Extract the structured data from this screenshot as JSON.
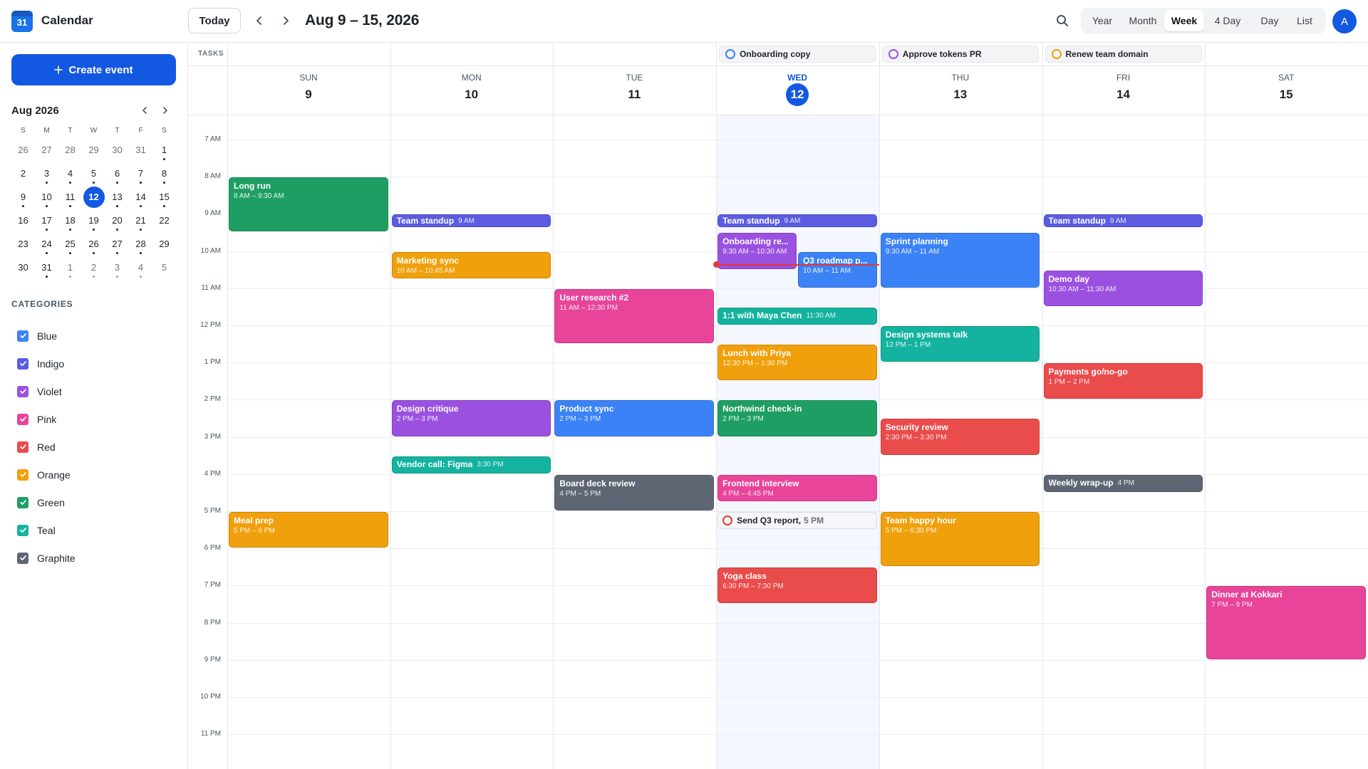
{
  "app": {
    "title": "Calendar",
    "logo_day": "31"
  },
  "toolbar": {
    "today_label": "Today",
    "range_title": "Aug 9 – 15, 2026"
  },
  "views": [
    {
      "label": "Year",
      "active": false
    },
    {
      "label": "Month",
      "active": false
    },
    {
      "label": "Week",
      "active": true
    },
    {
      "label": "4 Day",
      "active": false
    },
    {
      "label": "Day",
      "active": false
    },
    {
      "label": "List",
      "active": false
    }
  ],
  "user": {
    "avatar_initial": "A"
  },
  "sidebar": {
    "create_label": "Create event",
    "mini_calendar": {
      "title": "Aug 2026",
      "weekdays": [
        "S",
        "M",
        "T",
        "W",
        "T",
        "F",
        "S"
      ],
      "weeks": [
        [
          {
            "d": "26",
            "o": true,
            "dot": false
          },
          {
            "d": "27",
            "o": true,
            "dot": false
          },
          {
            "d": "28",
            "o": true,
            "dot": false
          },
          {
            "d": "29",
            "o": true,
            "dot": false
          },
          {
            "d": "30",
            "o": true,
            "dot": false
          },
          {
            "d": "31",
            "o": true,
            "dot": false
          },
          {
            "d": "1",
            "o": false,
            "dot": true
          }
        ],
        [
          {
            "d": "2",
            "o": false,
            "dot": false
          },
          {
            "d": "3",
            "o": false,
            "dot": true
          },
          {
            "d": "4",
            "o": false,
            "dot": true
          },
          {
            "d": "5",
            "o": false,
            "dot": true
          },
          {
            "d": "6",
            "o": false,
            "dot": true
          },
          {
            "d": "7",
            "o": false,
            "dot": true
          },
          {
            "d": "8",
            "o": false,
            "dot": true
          }
        ],
        [
          {
            "d": "9",
            "o": false,
            "dot": true
          },
          {
            "d": "10",
            "o": false,
            "dot": true
          },
          {
            "d": "11",
            "o": false,
            "dot": true
          },
          {
            "d": "12",
            "o": false,
            "dot": false,
            "today": true
          },
          {
            "d": "13",
            "o": false,
            "dot": true
          },
          {
            "d": "14",
            "o": false,
            "dot": true
          },
          {
            "d": "15",
            "o": false,
            "dot": true
          }
        ],
        [
          {
            "d": "16",
            "o": false,
            "dot": false
          },
          {
            "d": "17",
            "o": false,
            "dot": true
          },
          {
            "d": "18",
            "o": false,
            "dot": true
          },
          {
            "d": "19",
            "o": false,
            "dot": true
          },
          {
            "d": "20",
            "o": false,
            "dot": true
          },
          {
            "d": "21",
            "o": false,
            "dot": true
          },
          {
            "d": "22",
            "o": false,
            "dot": false
          }
        ],
        [
          {
            "d": "23",
            "o": false,
            "dot": false
          },
          {
            "d": "24",
            "o": false,
            "dot": true
          },
          {
            "d": "25",
            "o": false,
            "dot": true
          },
          {
            "d": "26",
            "o": false,
            "dot": true
          },
          {
            "d": "27",
            "o": false,
            "dot": true
          },
          {
            "d": "28",
            "o": false,
            "dot": true
          },
          {
            "d": "29",
            "o": false,
            "dot": false
          }
        ],
        [
          {
            "d": "30",
            "o": false,
            "dot": false
          },
          {
            "d": "31",
            "o": false,
            "dot": true
          },
          {
            "d": "1",
            "o": true,
            "dot": true
          },
          {
            "d": "2",
            "o": true,
            "dot": true
          },
          {
            "d": "3",
            "o": true,
            "dot": true
          },
          {
            "d": "4",
            "o": true,
            "dot": true
          },
          {
            "d": "5",
            "o": true,
            "dot": false
          }
        ]
      ]
    },
    "categories_title": "CATEGORIES",
    "categories": [
      {
        "label": "Blue",
        "color": "#3b82f6"
      },
      {
        "label": "Indigo",
        "color": "#5b5ce2"
      },
      {
        "label": "Violet",
        "color": "#9b51e0"
      },
      {
        "label": "Pink",
        "color": "#e8449a"
      },
      {
        "label": "Red",
        "color": "#ea4b4b"
      },
      {
        "label": "Orange",
        "color": "#f0a00c"
      },
      {
        "label": "Green",
        "color": "#1e9e63"
      },
      {
        "label": "Teal",
        "color": "#14b3a0"
      },
      {
        "label": "Graphite",
        "color": "#5f6673"
      }
    ]
  },
  "week": {
    "tasks_label": "TASKS",
    "tasks": [
      {
        "label": "Onboarding copy",
        "day": 3,
        "color": "#3b82f6"
      },
      {
        "label": "Approve tokens PR",
        "day": 4,
        "color": "#9b51e0"
      },
      {
        "label": "Renew team domain",
        "day": 5,
        "color": "#f0a00c"
      }
    ],
    "days": [
      {
        "name": "SUN",
        "num": "9",
        "today": false
      },
      {
        "name": "MON",
        "num": "10",
        "today": false
      },
      {
        "name": "TUE",
        "num": "11",
        "today": false
      },
      {
        "name": "WED",
        "num": "12",
        "today": true
      },
      {
        "name": "THU",
        "num": "13",
        "today": false
      },
      {
        "name": "FRI",
        "num": "14",
        "today": false
      },
      {
        "name": "SAT",
        "num": "15",
        "today": false
      }
    ],
    "hours": [
      "7 AM",
      "8 AM",
      "9 AM",
      "10 AM",
      "11 AM",
      "12 PM",
      "1 PM",
      "2 PM",
      "3 PM",
      "4 PM",
      "5 PM",
      "6 PM",
      "7 PM",
      "8 PM",
      "9 PM",
      "10 PM",
      "11 PM"
    ],
    "now_hour": 10.35,
    "events": [
      {
        "title": "Long run",
        "time": "8 AM – 9:30 AM",
        "day": 0,
        "start": 8,
        "end": 9.5,
        "color": "#1e9e63"
      },
      {
        "title": "Meal prep",
        "time": "5 PM – 6 PM",
        "day": 0,
        "start": 17,
        "end": 18,
        "color": "#f0a00c"
      },
      {
        "title": "Team standup",
        "time": "9 AM",
        "day": 1,
        "start": 9,
        "end": 9.35,
        "color": "#5b5ce2",
        "short": true
      },
      {
        "title": "Marketing sync",
        "time": "10 AM – 10:45 AM",
        "day": 1,
        "start": 10,
        "end": 10.75,
        "color": "#f0a00c"
      },
      {
        "title": "Design critique",
        "time": "2 PM – 3 PM",
        "day": 1,
        "start": 14,
        "end": 15,
        "color": "#9b51e0"
      },
      {
        "title": "Vendor call: Figma",
        "time": "3:30 PM",
        "day": 1,
        "start": 15.5,
        "end": 16,
        "color": "#14b3a0",
        "short": true
      },
      {
        "title": "User research #2",
        "time": "11 AM – 12:30 PM",
        "day": 2,
        "start": 11,
        "end": 12.5,
        "color": "#e8449a"
      },
      {
        "title": "Product sync",
        "time": "2 PM – 3 PM",
        "day": 2,
        "start": 14,
        "end": 15,
        "color": "#3b82f6"
      },
      {
        "title": "Board deck review",
        "time": "4 PM – 5 PM",
        "day": 2,
        "start": 16,
        "end": 17,
        "color": "#5f6673"
      },
      {
        "title": "Team standup",
        "time": "9 AM",
        "day": 3,
        "start": 9,
        "end": 9.35,
        "color": "#5b5ce2",
        "short": true
      },
      {
        "title": "Onboarding re...",
        "time": "9:30 AM – 10:30 AM",
        "day": 3,
        "start": 9.5,
        "end": 10.5,
        "color": "#9b51e0",
        "lane": 0,
        "lanes": 2,
        "wrap": true
      },
      {
        "title": "Q3 roadmap p...",
        "time": "10 AM – 11 AM",
        "day": 3,
        "start": 10,
        "end": 11,
        "color": "#3b82f6",
        "lane": 1,
        "lanes": 2
      },
      {
        "title": "1:1 with Maya Chen",
        "time": "11:30 AM",
        "day": 3,
        "start": 11.5,
        "end": 12,
        "color": "#14b3a0",
        "short": true
      },
      {
        "title": "Lunch with Priya",
        "time": "12:30 PM – 1:30 PM",
        "day": 3,
        "start": 12.5,
        "end": 13.5,
        "color": "#f0a00c"
      },
      {
        "title": "Northwind check-in",
        "time": "2 PM – 3 PM",
        "day": 3,
        "start": 14,
        "end": 15,
        "color": "#1e9e63"
      },
      {
        "title": "Frontend interview",
        "time": "4 PM – 4:45 PM",
        "day": 3,
        "start": 16,
        "end": 16.75,
        "color": "#e8449a"
      },
      {
        "title": "Yoga class",
        "time": "6:30 PM – 7:30 PM",
        "day": 3,
        "start": 18.5,
        "end": 19.5,
        "color": "#ea4b4b"
      },
      {
        "title": "Sprint planning",
        "time": "9:30 AM – 11 AM",
        "day": 4,
        "start": 9.5,
        "end": 11,
        "color": "#3b82f6"
      },
      {
        "title": "Design systems talk",
        "time": "12 PM – 1 PM",
        "day": 4,
        "start": 12,
        "end": 13,
        "color": "#14b3a0"
      },
      {
        "title": "Security review",
        "time": "2:30 PM – 3:30 PM",
        "day": 4,
        "start": 14.5,
        "end": 15.5,
        "color": "#ea4b4b"
      },
      {
        "title": "Team happy hour",
        "time": "5 PM – 6:30 PM",
        "day": 4,
        "start": 17,
        "end": 18.5,
        "color": "#f0a00c"
      },
      {
        "title": "Team standup",
        "time": "9 AM",
        "day": 5,
        "start": 9,
        "end": 9.35,
        "color": "#5b5ce2",
        "short": true
      },
      {
        "title": "Demo day",
        "time": "10:30 AM – 11:30 AM",
        "day": 5,
        "start": 10.5,
        "end": 11.5,
        "color": "#9b51e0"
      },
      {
        "title": "Payments go/no-go",
        "time": "1 PM – 2 PM",
        "day": 5,
        "start": 13,
        "end": 14,
        "color": "#ea4b4b"
      },
      {
        "title": "Weekly wrap-up",
        "time": "4 PM",
        "day": 5,
        "start": 16,
        "end": 16.5,
        "color": "#5f6673",
        "short": true
      },
      {
        "title": "Dinner at Kokkari",
        "time": "7 PM – 9 PM",
        "day": 6,
        "start": 19,
        "end": 21,
        "color": "#e8449a"
      }
    ],
    "timed_tasks": [
      {
        "title": "Send Q3 report,",
        "time": "5 PM",
        "day": 3,
        "start": 17
      }
    ]
  }
}
